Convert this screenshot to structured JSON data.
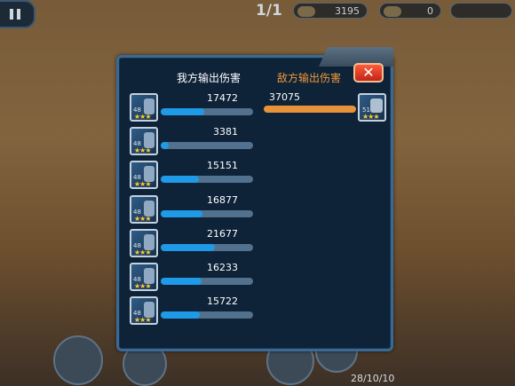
{
  "hud": {
    "wave": "1/1",
    "resource1": "3195",
    "resource2": "0",
    "resource3": "",
    "footer_text": "28/10/10"
  },
  "panel": {
    "tab_mine": "我方输出伤害",
    "tab_enemy": "敌方输出伤害",
    "close_label": "✕"
  },
  "units": [
    {
      "level": "48",
      "stars": "★★★",
      "damage": "17472"
    },
    {
      "level": "48",
      "stars": "★★★",
      "damage": "3381"
    },
    {
      "level": "48",
      "stars": "★★★",
      "damage": "15151"
    },
    {
      "level": "48",
      "stars": "★★★",
      "damage": "16877"
    },
    {
      "level": "48",
      "stars": "★★★",
      "damage": "21677"
    },
    {
      "level": "48",
      "stars": "★★★",
      "damage": "16233"
    },
    {
      "level": "48",
      "stars": "★★★",
      "damage": "15722"
    }
  ],
  "enemy": {
    "level": "51",
    "stars": "★★★",
    "damage": "37075"
  },
  "colors": {
    "ally_bar": "#1e9ae6",
    "enemy_bar": "#e8923a",
    "enemy_tab": "#f29a38"
  }
}
